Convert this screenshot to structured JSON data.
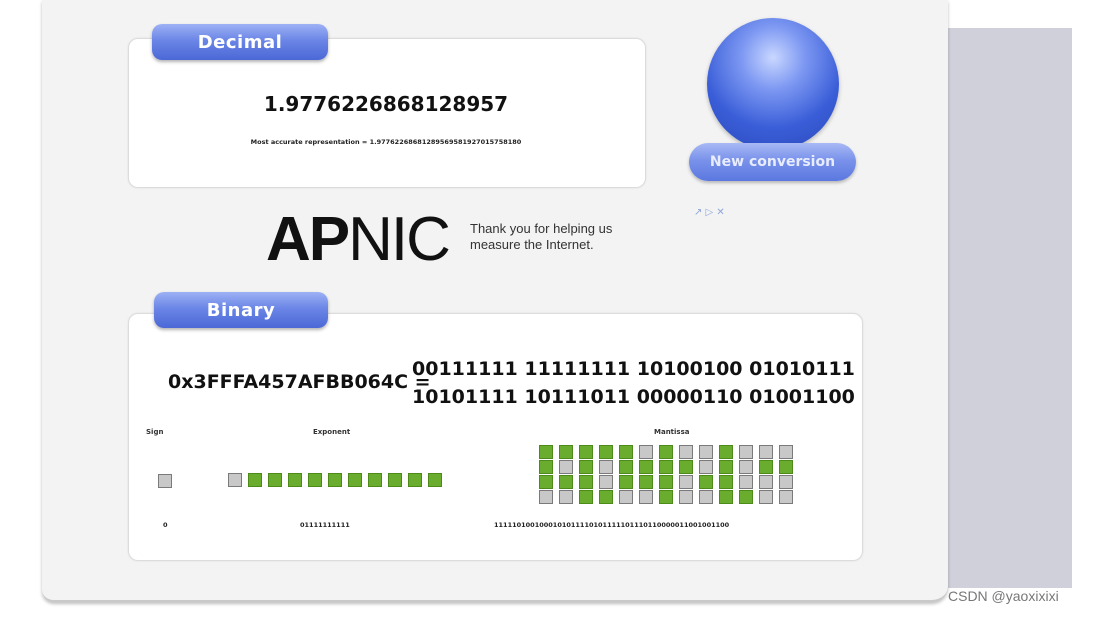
{
  "decimal": {
    "tab_label": "Decimal",
    "value": "1.9776226868128957",
    "accurate_text": "Most accurate representation = 1.97762268681289569581927015758180"
  },
  "new_conversion_label": "New conversion",
  "ad": {
    "logo_bold": "AP",
    "logo_light": "NIC",
    "text": "Thank you for helping us measure the Internet.",
    "icons": "↗ ▷ ✕"
  },
  "binary": {
    "tab_label": "Binary",
    "hex": "0x3FFFA457AFBB064C =",
    "line1": "00111111 11111111 10100100 01010111",
    "line2": "10101111 10111011 00000110 01001100",
    "sign_label": "Sign",
    "exponent_label": "Exponent",
    "mantissa_label": "Mantissa",
    "sign_bits": "0",
    "exponent_bits": "01111111111",
    "mantissa_bits": "1111101001000101011110101111101110110000011001001100"
  },
  "watermark": "CSDN @yaoxixixi",
  "colors": {
    "bit_on": "#6aac2e",
    "bit_off": "#c8c8c8",
    "accent_blue": "#5b78e0"
  }
}
